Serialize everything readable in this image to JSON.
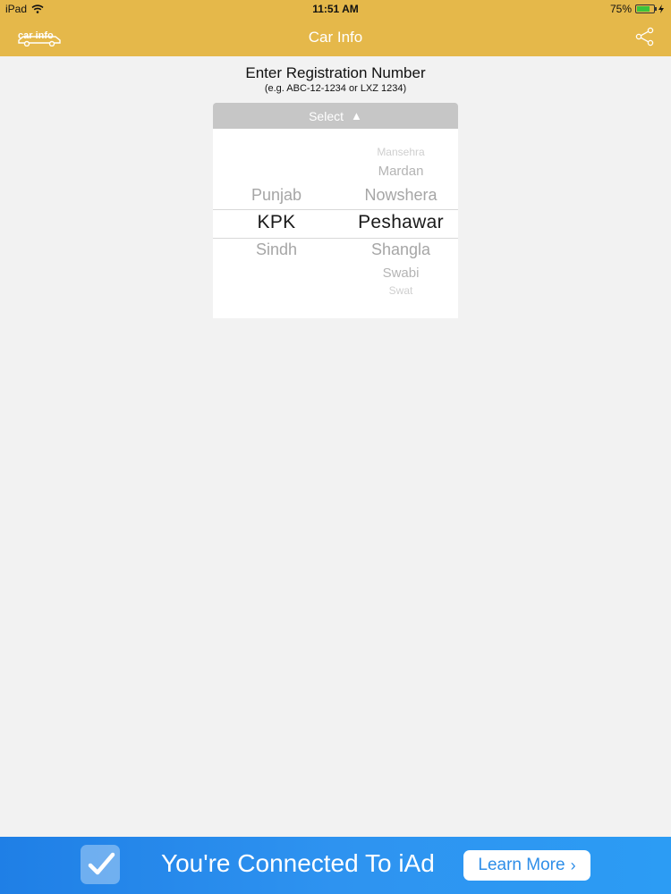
{
  "status_bar": {
    "device": "iPad",
    "time": "11:51 AM",
    "battery": "75%",
    "battery_level": 0.75
  },
  "nav": {
    "title": "Car Info",
    "logo_icon": "car-info-logo-icon",
    "share_icon": "share-icon"
  },
  "form": {
    "heading": "Enter Registration Number",
    "example": "(e.g. ABC-12-1234 or LXZ 1234)",
    "select_label": "Select"
  },
  "picker": {
    "provinces": [
      "Punjab",
      "KPK",
      "Sindh"
    ],
    "selected_province": "KPK",
    "cities": [
      "Mansehra",
      "Mardan",
      "Nowshera",
      "Peshawar",
      "Shangla",
      "Swabi",
      "Swat"
    ],
    "selected_city": "Peshawar"
  },
  "ad": {
    "text": "You're Connected To iAd",
    "button_label": "Learn More",
    "background_color": "#2e93f0"
  },
  "colors": {
    "nav_background": "#e5b84a",
    "page_background": "#f2f2f2"
  }
}
